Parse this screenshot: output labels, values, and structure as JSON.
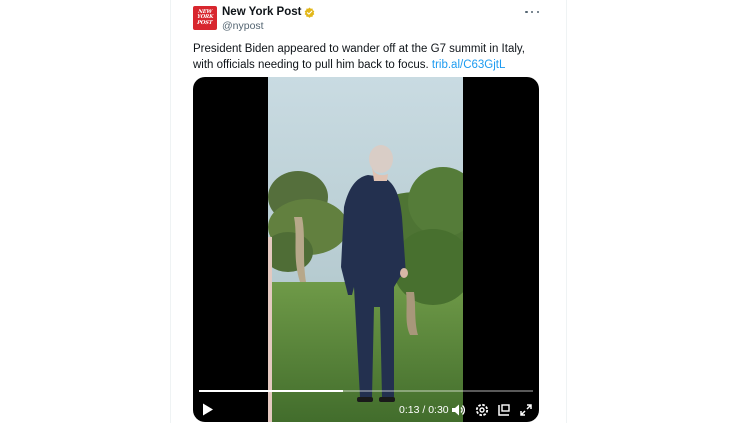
{
  "tweet": {
    "avatar_logo_lines": [
      "NEW",
      "YORK",
      "POST"
    ],
    "display_name": "New York Post",
    "handle": "@nypost",
    "text": "President Biden appeared to wander off at the G7 summit in Italy, with officials needing to pull him back to focus.",
    "link_text": "trib.al/C63GjtL"
  },
  "video": {
    "current_time": "0:13",
    "duration": "0:30",
    "time_display": "0:13 / 0:30",
    "progress_fraction": 0.43
  },
  "colors": {
    "brand_red": "#d8262e",
    "link_blue": "#1d9bf0",
    "verified_gold": "#e2b719"
  },
  "icons": [
    "verified-badge-icon",
    "more-icon",
    "play-icon",
    "volume-icon",
    "settings-icon",
    "dock-icon",
    "fullscreen-icon"
  ]
}
